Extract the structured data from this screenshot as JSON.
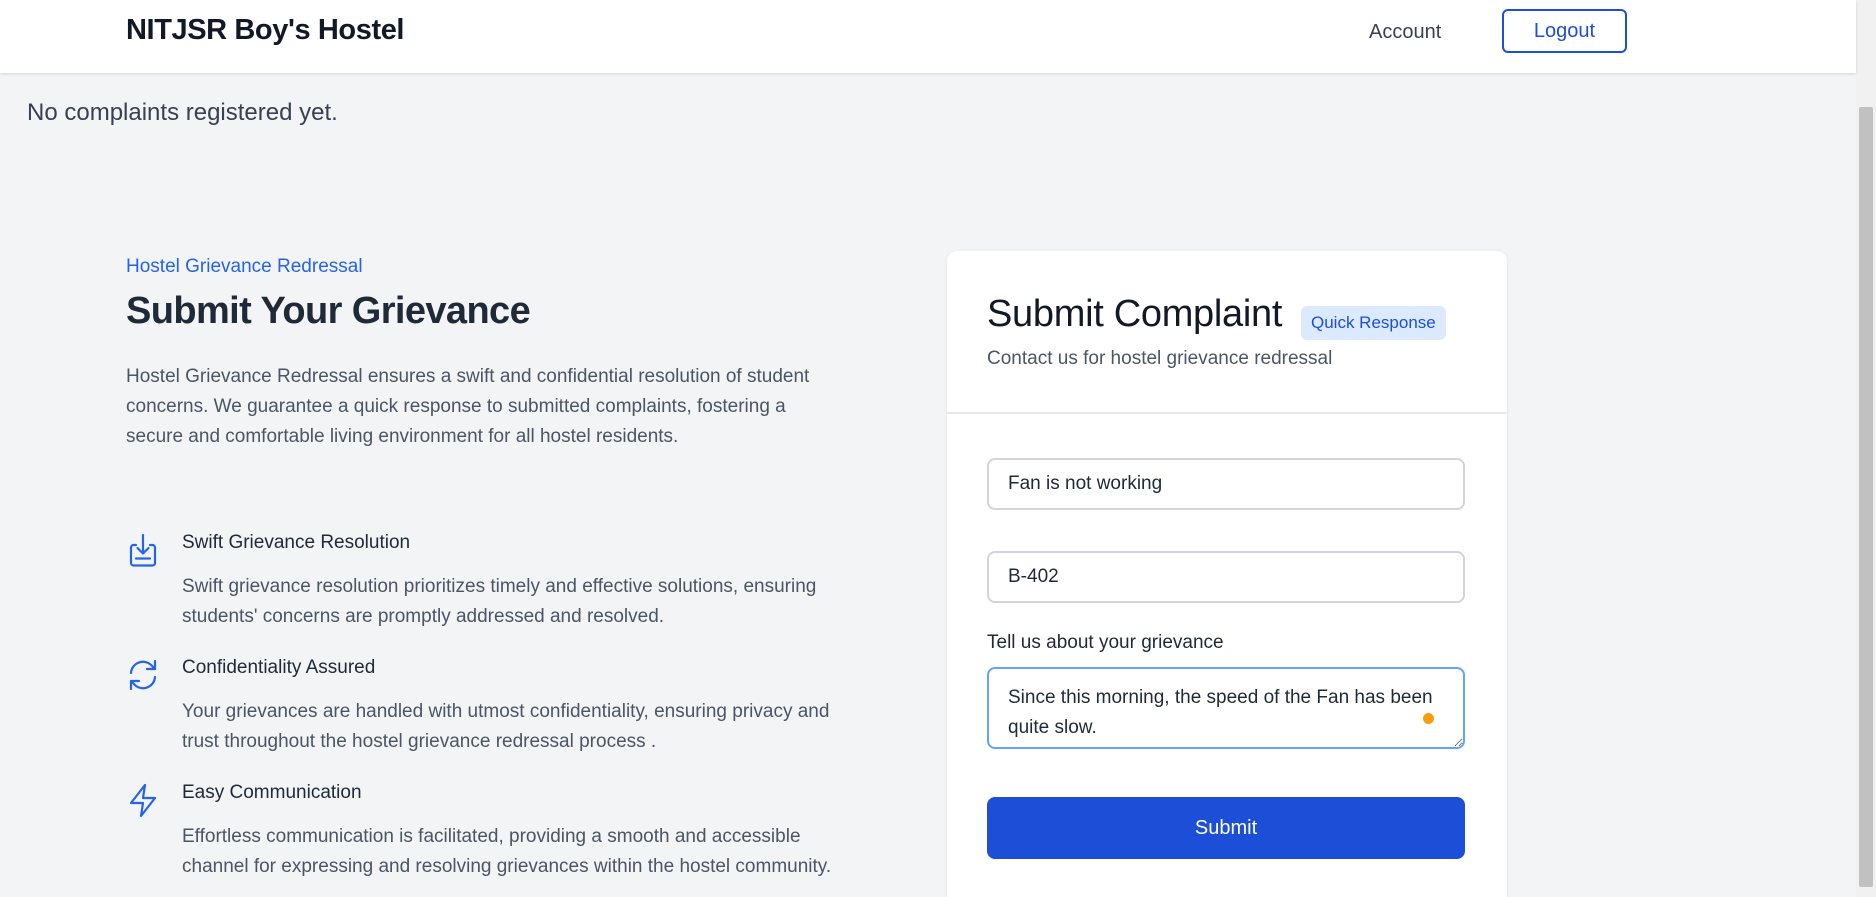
{
  "navbar": {
    "brand": "NITJSR Boy's Hostel",
    "account_label": "Account",
    "logout_label": "Logout"
  },
  "status": {
    "no_complaints": "No complaints registered yet."
  },
  "hero": {
    "eyebrow": "Hostel Grievance Redressal",
    "title": "Submit Your Grievance",
    "description": "Hostel Grievance Redressal ensures a swift and confidential resolution of student concerns. We guarantee a quick response to submitted complaints, fostering a secure and comfortable living environment for all hostel residents."
  },
  "features": [
    {
      "icon": "download-box-icon",
      "title": "Swift Grievance Resolution",
      "description": "Swift grievance resolution prioritizes timely and effective solutions, ensuring students' concerns are promptly addressed and resolved."
    },
    {
      "icon": "refresh-icon",
      "title": "Confidentiality Assured",
      "description": "Your grievances are handled with utmost confidentiality, ensuring privacy and trust throughout the hostel grievance redressal process ."
    },
    {
      "icon": "lightning-icon",
      "title": "Easy Communication",
      "description": "Effortless communication is facilitated, providing a smooth and accessible channel for expressing and resolving grievances within the hostel community."
    }
  ],
  "form": {
    "title": "Submit Complaint",
    "badge": "Quick Response",
    "subtitle": "Contact us for hostel grievance redressal",
    "complaint_value": "Fan is not working",
    "room_value": "B-402",
    "grievance_label": "Tell us about your grievance",
    "grievance_value": "Since this morning, the speed of the Fan has been quite slow.",
    "submit_label": "Submit"
  },
  "colors": {
    "accent": "#1d4ed8",
    "link": "#2563eb",
    "badge_bg": "#dbeafe",
    "background": "#f3f4f6"
  }
}
